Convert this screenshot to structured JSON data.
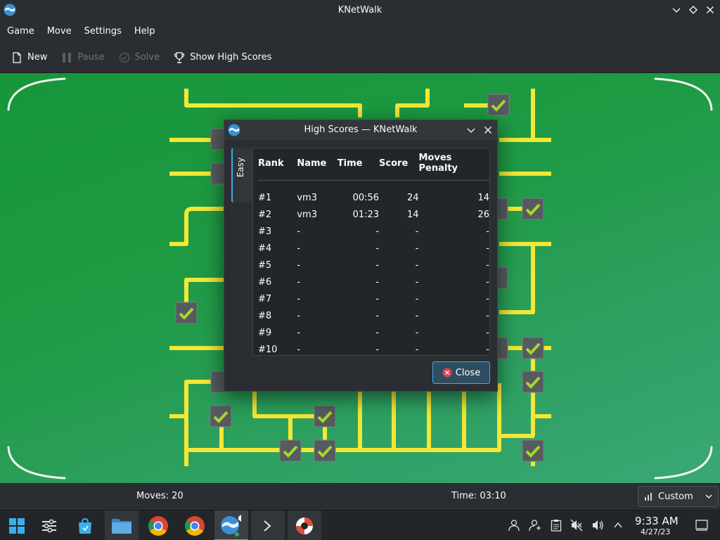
{
  "window": {
    "title": "KNetWalk"
  },
  "menu": [
    "Game",
    "Move",
    "Settings",
    "Help"
  ],
  "toolbar": {
    "new": "New",
    "pause": "Pause",
    "solve": "Solve",
    "high_scores": "Show High Scores"
  },
  "status": {
    "moves": "Moves: 20",
    "time": "Time: 03:10",
    "difficulty": "Custom"
  },
  "dialog": {
    "title": "High Scores — KNetWalk",
    "tab": "Easy",
    "columns": [
      "Rank",
      "Name",
      "Time",
      "Score",
      "Moves Penalty"
    ],
    "rows": [
      [
        "#1",
        "vm3",
        "00:56",
        "24",
        "14"
      ],
      [
        "#2",
        "vm3",
        "01:23",
        "14",
        "26"
      ],
      [
        "#3",
        "-",
        "-",
        "-",
        "-"
      ],
      [
        "#4",
        "-",
        "-",
        "-",
        "-"
      ],
      [
        "#5",
        "-",
        "-",
        "-",
        "-"
      ],
      [
        "#6",
        "-",
        "-",
        "-",
        "-"
      ],
      [
        "#7",
        "-",
        "-",
        "-",
        "-"
      ],
      [
        "#8",
        "-",
        "-",
        "-",
        "-"
      ],
      [
        "#9",
        "-",
        "-",
        "-",
        "-"
      ],
      [
        "#10",
        "-",
        "-",
        "-",
        "-"
      ]
    ],
    "close": "Close"
  },
  "taskbar": {
    "clock_time": "9:33 AM",
    "clock_date": "4/27/23",
    "apps": [
      "start-menu",
      "system-settings",
      "discover",
      "file-manager",
      "chrome",
      "chromium",
      "knetwalk",
      "konsole",
      "help-center"
    ]
  },
  "colors": {
    "accent": "#3daee9",
    "board_green": "#1f9a44",
    "pipe_yellow": "#f4e735",
    "check_green": "#a8d82a"
  }
}
